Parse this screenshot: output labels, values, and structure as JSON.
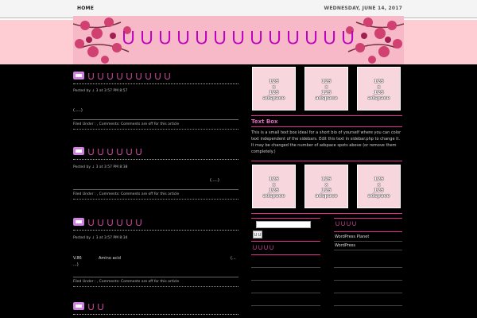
{
  "topbar": {
    "home": "HOME",
    "date": "WEDNESDAY, JUNE 14, 2017"
  },
  "site": {
    "title": "ＵＵＵＵＵＵＵＵＵＵＵＵＵ"
  },
  "colors": {
    "accent": "#e03090",
    "title_pink": "#d050a0",
    "header_band": "#fecdd3"
  },
  "posts": [
    {
      "title": "ＵＵＵＵＵＵＵＵＵ",
      "meta": "Posted by ↓ 3 at 3:57 PM 8:57",
      "body": "(.....)",
      "filed": "Filed Under : , Comments: Comments are off for this article"
    },
    {
      "title": "ＵＵＵＵＵＵ",
      "meta": "Posted by ↓ 3 at 3:57 PM 8:38",
      "body": "(.....)",
      "filed": "Filed Under : , Comments: Comments are off for this article"
    },
    {
      "title": "ＵＵＵＵＵＵ",
      "meta": "Posted by ↓ 3 at 3:57 PM 8:34",
      "body_left": "V.86",
      "body_mid": "Amino acid",
      "body_right": "(...",
      "body_cont": "...)",
      "filed": "Filed Under : , Comments: Comments are off for this article"
    },
    {
      "title": "ＵＵ"
    }
  ],
  "thumbs": {
    "caption_lines": [
      "125",
      "x",
      "125",
      "adspace"
    ]
  },
  "textbox": {
    "heading": "Text Box",
    "body": "This is a small text box ideal for a short bio of yourself where you can color text independent of the sidebars. Edit this text in sidebar.php to change it. It may be changed the number of adspace spots above (or remove them completely.)"
  },
  "sidebar": {
    "search_button": "ＵＵ",
    "left_title": "ＵＵＵＵ",
    "right_title": "ＵＵＵＵ",
    "links": [
      "WordPress Planet",
      "WordPress"
    ]
  }
}
